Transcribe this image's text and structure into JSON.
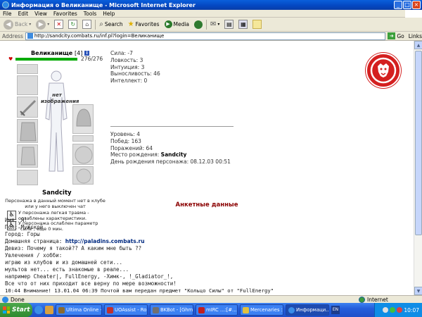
{
  "window": {
    "title": "Информация о Великанище - Microsoft Internet Explorer",
    "buttons": [
      "_",
      "□",
      "×"
    ]
  },
  "menu": [
    "File",
    "Edit",
    "View",
    "Favorites",
    "Tools",
    "Help"
  ],
  "toolbar": {
    "back": "Back",
    "search": "Search",
    "favorites": "Favorites",
    "media": "Media"
  },
  "address": {
    "label": "Address",
    "url": "http://sandcity.combats.ru/inf.pl?login=Великанище",
    "go": "Go",
    "links": "Links"
  },
  "character": {
    "name": "Великанище",
    "level": "[4]",
    "info_badge": "i",
    "hp": "276/276",
    "hp_fraction": 1.0,
    "no_image": "нет изображения",
    "city": "Sandcity",
    "status_note": "Персонажа в данный момент нет в клубе или у него выключен чат",
    "traumas": [
      "У персонажа легкая травма - ослаблены характеристики.",
      "У персонажа ослаблен параметр \"сила\", еще 0 мин."
    ]
  },
  "stats": {
    "strength": "Сила: -7",
    "agility": "Ловкость: 3",
    "intuition": "Интуиция: 3",
    "endurance": "Выносливость: 46",
    "intellect": "Интеллект: 0",
    "level": "Уровень: 4",
    "wins": "Побед: 163",
    "losses": "Поражений: 64",
    "birthplace_label": "Место рождения: ",
    "birthplace": "Sandcity",
    "birthday": "День рождения персонажа: 08.12.03 00:51"
  },
  "profile": {
    "section_title": "Анкетные данные",
    "name": "Имя: Я!",
    "gender": "Пол: Мужской",
    "city": "Город: Горы",
    "homepage_label": "Домашняя страница: ",
    "homepage": "http://paladins.combats.ru",
    "motto": "Девиз: Почему я такой?? А каким мне быть ??",
    "hobbies_label": "Увлечения / хобби:",
    "hobbies": [
      "играю из клубов и из домашней сети...",
      "мультов нет... есть знакомые в реале...",
      "например Cheater|, FullEnergy, -Химк-, !_Gladiator_!,",
      "Все что от них приходит все верну по мере возможности!"
    ],
    "chat_line": "10:44 Внимание! 13.01.04 06:39 Почтой вам передан предмет \"Кольцо Силы\" от \"FullEnergy\""
  },
  "statusbar": {
    "text": "Done",
    "zone": "Internet"
  },
  "taskbar": {
    "start": "Start",
    "tasks": [
      "Ultima Online - ...",
      "UOAssist - Ro...",
      "BKBot - [Ghm...",
      "mIRC ...:[#...",
      "Mercenaries : ...",
      "Информаци..."
    ],
    "lang": "EN",
    "clock": "10:07"
  },
  "colors": {
    "hp_bar": "#00aa00",
    "section_title": "#8b0000",
    "clan_logo": "#d42020"
  }
}
